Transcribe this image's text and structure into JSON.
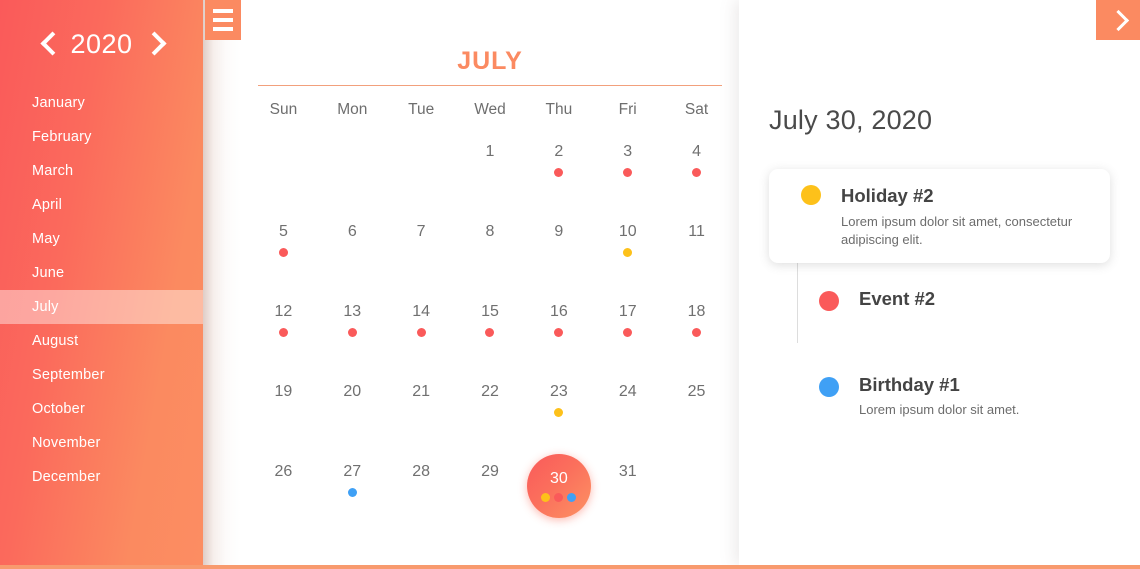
{
  "sidebar": {
    "year": "2020",
    "prev_year_label": "‹",
    "next_year_label": "›",
    "months": [
      {
        "label": "January",
        "active": false
      },
      {
        "label": "February",
        "active": false
      },
      {
        "label": "March",
        "active": false
      },
      {
        "label": "April",
        "active": false
      },
      {
        "label": "May",
        "active": false
      },
      {
        "label": "June",
        "active": false
      },
      {
        "label": "July",
        "active": true
      },
      {
        "label": "August",
        "active": false
      },
      {
        "label": "September",
        "active": false
      },
      {
        "label": "October",
        "active": false
      },
      {
        "label": "November",
        "active": false
      },
      {
        "label": "December",
        "active": false
      }
    ]
  },
  "controls": {
    "menu_icon": "hamburger-icon",
    "panel_toggle_icon": "chevron-right-icon"
  },
  "calendar": {
    "month_title": "JULY",
    "weekdays": [
      "Sun",
      "Mon",
      "Tue",
      "Wed",
      "Thu",
      "Fri",
      "Sat"
    ],
    "selected_day": 30,
    "weeks": [
      [
        {
          "day": "",
          "dots": []
        },
        {
          "day": "",
          "dots": []
        },
        {
          "day": "",
          "dots": []
        },
        {
          "day": "1",
          "dots": []
        },
        {
          "day": "2",
          "dots": [
            "red"
          ]
        },
        {
          "day": "3",
          "dots": [
            "red"
          ]
        },
        {
          "day": "4",
          "dots": [
            "red"
          ]
        }
      ],
      [
        {
          "day": "5",
          "dots": [
            "red"
          ]
        },
        {
          "day": "6",
          "dots": []
        },
        {
          "day": "7",
          "dots": []
        },
        {
          "day": "8",
          "dots": []
        },
        {
          "day": "9",
          "dots": []
        },
        {
          "day": "10",
          "dots": [
            "yellow"
          ]
        },
        {
          "day": "11",
          "dots": []
        }
      ],
      [
        {
          "day": "12",
          "dots": [
            "red"
          ]
        },
        {
          "day": "13",
          "dots": [
            "red"
          ]
        },
        {
          "day": "14",
          "dots": [
            "red"
          ]
        },
        {
          "day": "15",
          "dots": [
            "red"
          ]
        },
        {
          "day": "16",
          "dots": [
            "red"
          ]
        },
        {
          "day": "17",
          "dots": [
            "red"
          ]
        },
        {
          "day": "18",
          "dots": [
            "red"
          ]
        }
      ],
      [
        {
          "day": "19",
          "dots": []
        },
        {
          "day": "20",
          "dots": []
        },
        {
          "day": "21",
          "dots": []
        },
        {
          "day": "22",
          "dots": []
        },
        {
          "day": "23",
          "dots": [
            "yellow"
          ]
        },
        {
          "day": "24",
          "dots": []
        },
        {
          "day": "25",
          "dots": []
        }
      ],
      [
        {
          "day": "26",
          "dots": []
        },
        {
          "day": "27",
          "dots": [
            "blue"
          ]
        },
        {
          "day": "28",
          "dots": []
        },
        {
          "day": "29",
          "dots": []
        },
        {
          "day": "30",
          "dots": [
            "yellow",
            "red",
            "blue"
          ],
          "selected": true
        },
        {
          "day": "31",
          "dots": []
        },
        {
          "day": "",
          "dots": []
        }
      ]
    ]
  },
  "details": {
    "date": "July 30, 2020",
    "events": [
      {
        "title": "Holiday #2",
        "description": "Lorem ipsum dolor sit amet, consectetur adipiscing elit.",
        "color": "yellow",
        "card": true
      },
      {
        "title": "Event #2",
        "description": "",
        "color": "red",
        "card": false
      },
      {
        "title": "Birthday #1",
        "description": "Lorem ipsum dolor sit amet.",
        "color": "blue",
        "card": false
      }
    ]
  },
  "colors": {
    "red": "#fa5a5a",
    "yellow": "#fdc11a",
    "blue": "#3fa0f5",
    "accent": "#fb8a61",
    "sidebar_start": "#fa5a5a",
    "sidebar_end": "#fc8d62",
    "text": "#707070"
  }
}
